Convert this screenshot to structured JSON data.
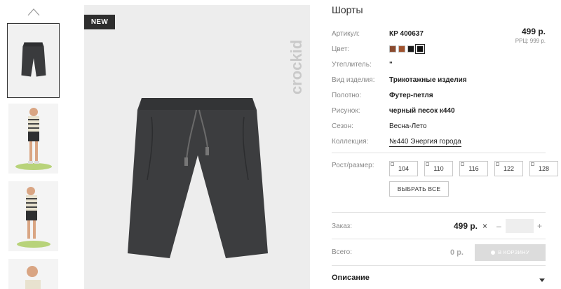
{
  "gallery": {
    "badge": "NEW",
    "brand_mark": "crockid",
    "thumbnails": [
      "shorts-flat",
      "model-front",
      "model-side",
      "model-closeup"
    ]
  },
  "product": {
    "title": "Шорты",
    "price": "499 р.",
    "rrp": "РРЦ: 999 р.",
    "attributes": [
      {
        "label": "Артикул:",
        "value": "КР 400637"
      },
      {
        "label": "Цвет:",
        "value": ""
      },
      {
        "label": "Утеплитель:",
        "value": "\""
      },
      {
        "label": "Вид изделия:",
        "value": "Трикотажные изделия"
      },
      {
        "label": "Полотно:",
        "value": "Футер-петля"
      },
      {
        "label": "Рисунок:",
        "value": "черный песок к440"
      },
      {
        "label": "Сезон:",
        "value": "Весна-Лето"
      },
      {
        "label": "Коллекция:",
        "value": "№440 Энергия города"
      }
    ],
    "colors": [
      "#8a4a2e",
      "#a0522d",
      "#1a1a1a",
      "#111111"
    ],
    "sizes_label": "Рост/размер:",
    "sizes": [
      "104",
      "110",
      "116",
      "122",
      "128"
    ],
    "select_all": "ВЫБРАТЬ ВСЕ"
  },
  "order": {
    "order_label": "Заказ:",
    "order_price": "499 р.",
    "remove": "×",
    "minus": "–",
    "plus": "+",
    "quantity": "",
    "total_label": "Всего:",
    "total_value": "0 р.",
    "cart_button": "В КОРЗИНУ"
  },
  "description": {
    "title": "Описание"
  }
}
